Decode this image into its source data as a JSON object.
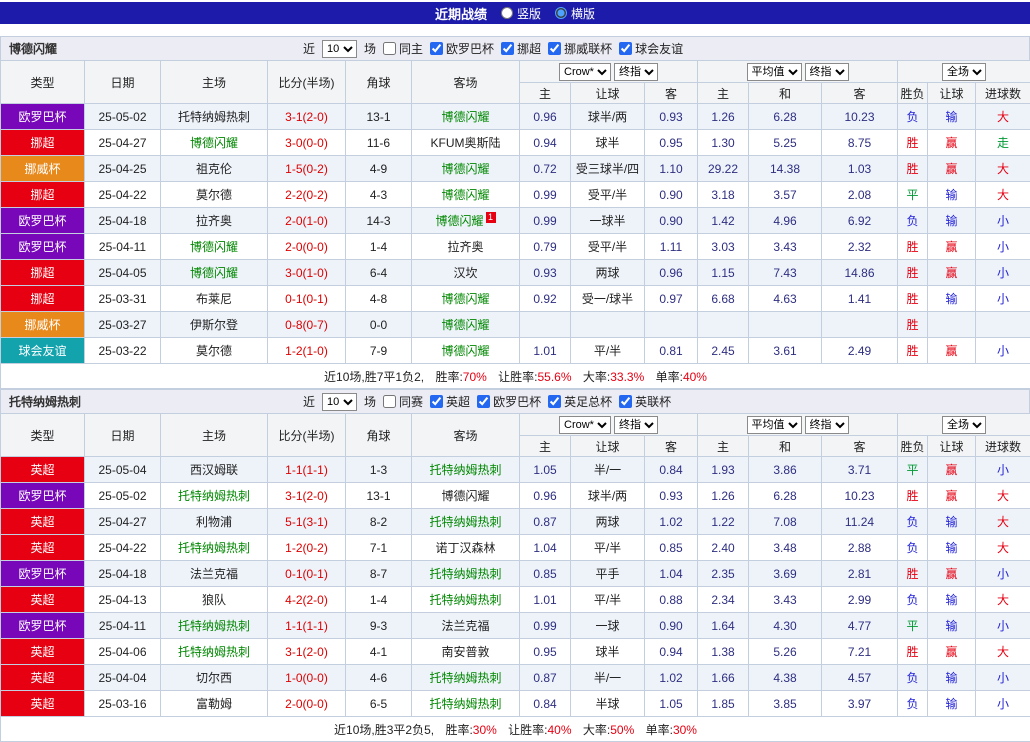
{
  "header": {
    "title": "近期战绩",
    "layout_options": [
      {
        "label": "竖版",
        "selected": false
      },
      {
        "label": "横版",
        "selected": true
      }
    ]
  },
  "colors": {
    "topbar_bg": "#1d1caa",
    "team_highlight": "#008800",
    "score": "#dd0000",
    "league": {
      "欧罗巴杯": "#7707b8",
      "挪超": "#e60012",
      "挪威杯": "#e8891c",
      "球会友谊": "#13a3ad",
      "英超": "#e60012"
    },
    "result": {
      "胜": "#e60012",
      "赢": "#e60012",
      "大": "#e60012",
      "平": "#009933",
      "走": "#009933",
      "负": "#2323d6",
      "输": "#2323d6",
      "小": "#2323d6"
    }
  },
  "table_header": {
    "col_type": "类型",
    "col_date": "日期",
    "col_home": "主场",
    "col_score": "比分(半场)",
    "col_corner": "角球",
    "col_away": "客场",
    "odds_source_select": "Crow*",
    "odds_final_select": "终指",
    "avg_select": "平均值",
    "avg_final_select": "终指",
    "scope_select": "全场",
    "sub": {
      "home": "主",
      "handicap": "让球",
      "away": "客",
      "avg_home": "主",
      "avg_draw": "和",
      "avg_away": "客",
      "result": "胜负",
      "handicap_result": "让球",
      "goals": "进球数"
    }
  },
  "sections": [
    {
      "team": "博德闪耀",
      "filter": {
        "prefix": "近",
        "count": "10",
        "suffix": "场",
        "same": {
          "label": "同主",
          "checked": false
        },
        "leagues": [
          {
            "label": "欧罗巴杯",
            "checked": true
          },
          {
            "label": "挪超",
            "checked": true
          },
          {
            "label": "挪威联杯",
            "checked": true
          },
          {
            "label": "球会友谊",
            "checked": true
          }
        ]
      },
      "rows": [
        {
          "league": "欧罗巴杯",
          "date": "25-05-02",
          "home": "托特纳姆热刺",
          "score": "3-1(2-0)",
          "corner": "13-1",
          "away": "博德闪耀",
          "focus": "away",
          "odds_home": "0.96",
          "handicap": "球半/两",
          "odds_away": "0.93",
          "avg_home": "1.26",
          "avg_draw": "6.28",
          "avg_away": "10.23",
          "result": "负",
          "handicap_result": "输",
          "goals": "大"
        },
        {
          "league": "挪超",
          "date": "25-04-27",
          "home": "博德闪耀",
          "focus": "home",
          "score": "3-0(0-0)",
          "corner": "11-6",
          "away": "KFUM奥斯陆",
          "odds_home": "0.94",
          "handicap": "球半",
          "odds_away": "0.95",
          "avg_home": "1.30",
          "avg_draw": "5.25",
          "avg_away": "8.75",
          "result": "胜",
          "handicap_result": "赢",
          "goals": "走"
        },
        {
          "league": "挪威杯",
          "date": "25-04-25",
          "home": "祖克伦",
          "score": "1-5(0-2)",
          "corner": "4-9",
          "away": "博德闪耀",
          "focus": "away",
          "odds_home": "0.72",
          "handicap": "受三球半/四",
          "odds_away": "1.10",
          "avg_home": "29.22",
          "avg_draw": "14.38",
          "avg_away": "1.03",
          "result": "胜",
          "handicap_result": "赢",
          "goals": "大"
        },
        {
          "league": "挪超",
          "date": "25-04-22",
          "home": "莫尔德",
          "score": "2-2(0-2)",
          "corner": "4-3",
          "away": "博德闪耀",
          "focus": "away",
          "odds_home": "0.99",
          "handicap": "受平/半",
          "odds_away": "0.90",
          "avg_home": "3.18",
          "avg_draw": "3.57",
          "avg_away": "2.08",
          "result": "平",
          "handicap_result": "输",
          "goals": "大"
        },
        {
          "league": "欧罗巴杯",
          "date": "25-04-18",
          "home": "拉齐奥",
          "score": "2-0(1-0)",
          "corner": "14-3",
          "away": "博德闪耀",
          "away_badge": "1",
          "focus": "away",
          "odds_home": "0.99",
          "handicap": "一球半",
          "odds_away": "0.90",
          "avg_home": "1.42",
          "avg_draw": "4.96",
          "avg_away": "6.92",
          "result": "负",
          "handicap_result": "输",
          "goals": "小"
        },
        {
          "league": "欧罗巴杯",
          "date": "25-04-11",
          "home": "博德闪耀",
          "focus": "home",
          "score": "2-0(0-0)",
          "corner": "1-4",
          "away": "拉齐奥",
          "odds_home": "0.79",
          "handicap": "受平/半",
          "odds_away": "1.11",
          "avg_home": "3.03",
          "avg_draw": "3.43",
          "avg_away": "2.32",
          "result": "胜",
          "handicap_result": "赢",
          "goals": "小"
        },
        {
          "league": "挪超",
          "date": "25-04-05",
          "home": "博德闪耀",
          "focus": "home",
          "score": "3-0(1-0)",
          "corner": "6-4",
          "away": "汉坎",
          "odds_home": "0.93",
          "handicap": "两球",
          "odds_away": "0.96",
          "avg_home": "1.15",
          "avg_draw": "7.43",
          "avg_away": "14.86",
          "result": "胜",
          "handicap_result": "赢",
          "goals": "小"
        },
        {
          "league": "挪超",
          "date": "25-03-31",
          "home": "布莱尼",
          "score": "0-1(0-1)",
          "corner": "4-8",
          "away": "博德闪耀",
          "focus": "away",
          "odds_home": "0.92",
          "handicap": "受一/球半",
          "odds_away": "0.97",
          "avg_home": "6.68",
          "avg_draw": "4.63",
          "avg_away": "1.41",
          "result": "胜",
          "handicap_result": "输",
          "goals": "小"
        },
        {
          "league": "挪威杯",
          "date": "25-03-27",
          "home": "伊斯尔登",
          "score": "0-8(0-7)",
          "corner": "0-0",
          "away": "博德闪耀",
          "focus": "away",
          "odds_home": "",
          "handicap": "",
          "odds_away": "",
          "avg_home": "",
          "avg_draw": "",
          "avg_away": "",
          "result": "胜",
          "handicap_result": "",
          "goals": ""
        },
        {
          "league": "球会友谊",
          "date": "25-03-22",
          "home": "莫尔德",
          "score": "1-2(1-0)",
          "corner": "7-9",
          "away": "博德闪耀",
          "focus": "away",
          "odds_home": "1.01",
          "handicap": "平/半",
          "odds_away": "0.81",
          "avg_home": "2.45",
          "avg_draw": "3.61",
          "avg_away": "2.49",
          "result": "胜",
          "handicap_result": "赢",
          "goals": "小"
        }
      ],
      "summary": {
        "lead": "近10场,胜7平1负2,",
        "stats": [
          {
            "label": "胜率:",
            "value": "70%"
          },
          {
            "label": "让胜率:",
            "value": "55.6%"
          },
          {
            "label": "大率:",
            "value": "33.3%"
          },
          {
            "label": "单率:",
            "value": "40%"
          }
        ]
      }
    },
    {
      "team": "托特纳姆热刺",
      "filter": {
        "prefix": "近",
        "count": "10",
        "suffix": "场",
        "same": {
          "label": "同赛",
          "checked": false
        },
        "leagues": [
          {
            "label": "英超",
            "checked": true
          },
          {
            "label": "欧罗巴杯",
            "checked": true
          },
          {
            "label": "英足总杯",
            "checked": true
          },
          {
            "label": "英联杯",
            "checked": true
          }
        ]
      },
      "rows": [
        {
          "league": "英超",
          "date": "25-05-04",
          "home": "西汉姆联",
          "score": "1-1(1-1)",
          "corner": "1-3",
          "away": "托特纳姆热刺",
          "focus": "away",
          "odds_home": "1.05",
          "handicap": "半/一",
          "odds_away": "0.84",
          "avg_home": "1.93",
          "avg_draw": "3.86",
          "avg_away": "3.71",
          "result": "平",
          "handicap_result": "赢",
          "goals": "小"
        },
        {
          "league": "欧罗巴杯",
          "date": "25-05-02",
          "home": "托特纳姆热刺",
          "focus": "home",
          "score": "3-1(2-0)",
          "corner": "13-1",
          "away": "博德闪耀",
          "odds_home": "0.96",
          "handicap": "球半/两",
          "odds_away": "0.93",
          "avg_home": "1.26",
          "avg_draw": "6.28",
          "avg_away": "10.23",
          "result": "胜",
          "handicap_result": "赢",
          "goals": "大"
        },
        {
          "league": "英超",
          "date": "25-04-27",
          "home": "利物浦",
          "score": "5-1(3-1)",
          "corner": "8-2",
          "away": "托特纳姆热刺",
          "focus": "away",
          "odds_home": "0.87",
          "handicap": "两球",
          "odds_away": "1.02",
          "avg_home": "1.22",
          "avg_draw": "7.08",
          "avg_away": "11.24",
          "result": "负",
          "handicap_result": "输",
          "goals": "大"
        },
        {
          "league": "英超",
          "date": "25-04-22",
          "home": "托特纳姆热刺",
          "focus": "home",
          "score": "1-2(0-2)",
          "corner": "7-1",
          "away": "诺丁汉森林",
          "odds_home": "1.04",
          "handicap": "平/半",
          "odds_away": "0.85",
          "avg_home": "2.40",
          "avg_draw": "3.48",
          "avg_away": "2.88",
          "result": "负",
          "handicap_result": "输",
          "goals": "大"
        },
        {
          "league": "欧罗巴杯",
          "date": "25-04-18",
          "home": "法兰克福",
          "score": "0-1(0-1)",
          "corner": "8-7",
          "away": "托特纳姆热刺",
          "focus": "away",
          "odds_home": "0.85",
          "handicap": "平手",
          "odds_away": "1.04",
          "avg_home": "2.35",
          "avg_draw": "3.69",
          "avg_away": "2.81",
          "result": "胜",
          "handicap_result": "赢",
          "goals": "小"
        },
        {
          "league": "英超",
          "date": "25-04-13",
          "home": "狼队",
          "score": "4-2(2-0)",
          "corner": "1-4",
          "away": "托特纳姆热刺",
          "focus": "away",
          "odds_home": "1.01",
          "handicap": "平/半",
          "odds_away": "0.88",
          "avg_home": "2.34",
          "avg_draw": "3.43",
          "avg_away": "2.99",
          "result": "负",
          "handicap_result": "输",
          "goals": "大"
        },
        {
          "league": "欧罗巴杯",
          "date": "25-04-11",
          "home": "托特纳姆热刺",
          "focus": "home",
          "score": "1-1(1-1)",
          "corner": "9-3",
          "away": "法兰克福",
          "odds_home": "0.99",
          "handicap": "一球",
          "odds_away": "0.90",
          "avg_home": "1.64",
          "avg_draw": "4.30",
          "avg_away": "4.77",
          "result": "平",
          "handicap_result": "输",
          "goals": "小"
        },
        {
          "league": "英超",
          "date": "25-04-06",
          "home": "托特纳姆热刺",
          "focus": "home",
          "score": "3-1(2-0)",
          "corner": "4-1",
          "away": "南安普敦",
          "odds_home": "0.95",
          "handicap": "球半",
          "odds_away": "0.94",
          "avg_home": "1.38",
          "avg_draw": "5.26",
          "avg_away": "7.21",
          "result": "胜",
          "handicap_result": "赢",
          "goals": "大"
        },
        {
          "league": "英超",
          "date": "25-04-04",
          "home": "切尔西",
          "score": "1-0(0-0)",
          "corner": "4-6",
          "away": "托特纳姆热刺",
          "focus": "away",
          "odds_home": "0.87",
          "handicap": "半/一",
          "odds_away": "1.02",
          "avg_home": "1.66",
          "avg_draw": "4.38",
          "avg_away": "4.57",
          "result": "负",
          "handicap_result": "输",
          "goals": "小"
        },
        {
          "league": "英超",
          "date": "25-03-16",
          "home": "富勒姆",
          "score": "2-0(0-0)",
          "corner": "6-5",
          "away": "托特纳姆热刺",
          "focus": "away",
          "odds_home": "0.84",
          "handicap": "半球",
          "odds_away": "1.05",
          "avg_home": "1.85",
          "avg_draw": "3.85",
          "avg_away": "3.97",
          "result": "负",
          "handicap_result": "输",
          "goals": "小"
        }
      ],
      "summary": {
        "lead": "近10场,胜3平2负5,",
        "stats": [
          {
            "label": "胜率:",
            "value": "30%"
          },
          {
            "label": "让胜率:",
            "value": "40%"
          },
          {
            "label": "大率:",
            "value": "50%"
          },
          {
            "label": "单率:",
            "value": "30%"
          }
        ]
      }
    }
  ]
}
